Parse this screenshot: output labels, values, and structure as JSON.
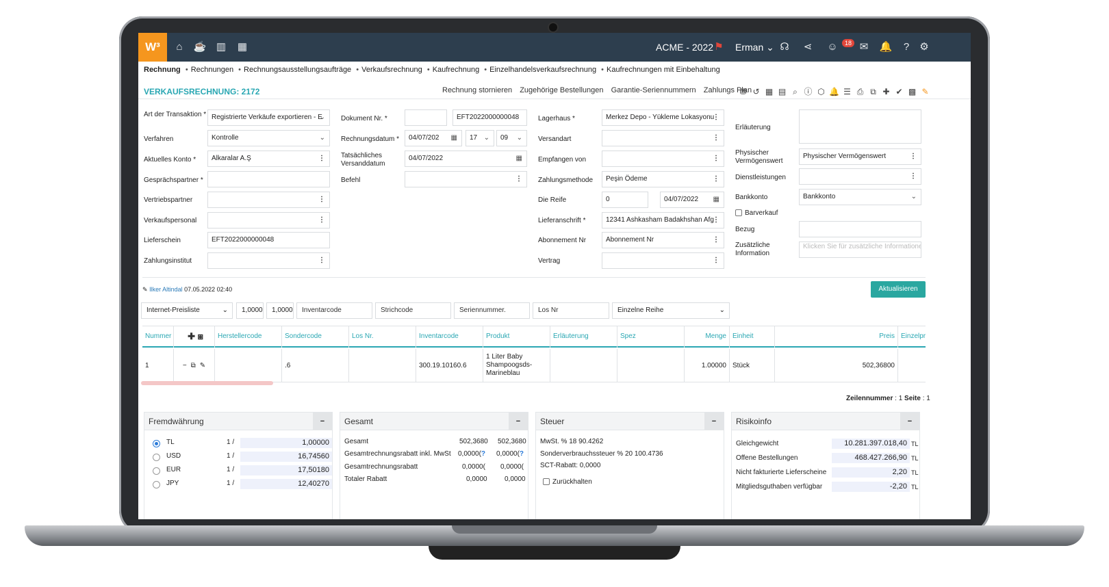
{
  "topbar": {
    "logo": "W³",
    "company": "ACME - 2022",
    "user": "Erman",
    "notifications_count": "18",
    "icons": [
      "home-icon",
      "coffee-icon",
      "chart-icon",
      "calendar-icon",
      "headset-icon",
      "share-icon",
      "smiley-icon",
      "chat-icon",
      "bell-icon",
      "help-icon",
      "gear-icon"
    ]
  },
  "breadcrumb": [
    "Rechnung",
    "Rechnungen",
    "Rechnungsausstellungsaufträge",
    "Verkaufsrechnung",
    "Kaufrechnung",
    "Einzelhandelsverkaufsrechnung",
    "Kaufrechnungen mit Einbehaltung"
  ],
  "title": "VERKAUFSRECHNUNG: 2172",
  "actions": [
    "Rechnung stornieren",
    "Zugehörige Bestellungen",
    "Garantie-Seriennummern",
    "Zahlungs Plan"
  ],
  "toolbar_glyphs": [
    "⛃",
    "↺",
    "▦",
    "▤",
    "⌕",
    "ⓘ",
    "⬡",
    "🔔",
    "☰",
    "⎙",
    "⧉",
    "✚",
    "✔",
    "▩",
    "✎"
  ],
  "form": {
    "col1": {
      "art_label": "Art der Transaktion *",
      "art_value": "Registrierte Verkäufe exportieren - E",
      "verfahren_label": "Verfahren",
      "verfahren_value": "Kontrolle",
      "konto_label": "Aktuelles Konto *",
      "konto_value": "Alkaralar A.Ş",
      "partner_label": "Gesprächspartner *",
      "vertrieb_label": "Vertriebspartner",
      "personal_label": "Verkaufspersonal",
      "lieferschein_label": "Lieferschein",
      "lieferschein_value": "EFT2022000000048",
      "zahlungsinst_label": "Zahlungsinstitut"
    },
    "col2": {
      "dokument_label": "Dokument Nr. *",
      "dokument_value": "EFT2022000000048",
      "rdatum_label": "Rechnungsdatum *",
      "rdatum_value": "04/07/202",
      "hour": "17",
      "minute": "09",
      "tdatum_label": "Tatsächliches Versanddatum",
      "tdatum_value": "04/07/2022",
      "befehl_label": "Befehl"
    },
    "col3": {
      "lagerhaus_label": "Lagerhaus *",
      "lagerhaus_value": "Merkez Depo - Yükleme Lokasyonu",
      "versandart_label": "Versandart",
      "empfangen_label": "Empfangen von",
      "zahlungsmethode_label": "Zahlungsmethode",
      "zahlungsmethode_value": "Peşin Ödeme",
      "reife_label": "Die Reife",
      "reife_value": "0",
      "reife_date": "04/07/2022",
      "lieferanschrift_label": "Lieferanschrift *",
      "lieferanschrift_value": "12341 Ashkasham Badakhshan Afg",
      "abonnement_label": "Abonnement Nr",
      "abonnement_placeholder": "Abonnement Nr",
      "vertrag_label": "Vertrag"
    },
    "col4": {
      "erlaeuterung_label": "Erläuterung",
      "physisch_label": "Physischer Vermögenswert",
      "physisch_placeholder": "Physischer Vermögenswert",
      "dienst_label": "Dienstleistungen",
      "bankkonto_label": "Bankkonto",
      "bankkonto_value": "Bankkonto",
      "barverkauf_label": "Barverkauf",
      "bezug_label": "Bezug",
      "zusatz_label": "Zusätzliche Information",
      "zusatz_button": "Klicken Sie für zusätzliche Informationen"
    }
  },
  "author": {
    "name": "Ilker Altindal",
    "timestamp": "07.05.2022 02:40"
  },
  "update_button": "Aktualisieren",
  "filters": {
    "preisliste": "Internet-Preisliste",
    "qty1": "1,0000",
    "qty2": "1,0000",
    "inventarcode": "Inventarcode",
    "strichcode": "Strichcode",
    "seriennummer": "Seriennummer.",
    "losnr": "Los Nr",
    "reihe": "Einzelne Reihe"
  },
  "table": {
    "headers": [
      "Nummer",
      "Herstellercode",
      "Sondercode",
      "Los Nr.",
      "Inventarcode",
      "Produkt",
      "Erläuterung",
      "Spez",
      "Menge",
      "Einheit",
      "Preis",
      "Einzelpr"
    ],
    "row": {
      "nummer": "1",
      "herstellercode": "",
      "sondercode": ".6",
      "losnr": "",
      "inventarcode": "300.19.10160.6",
      "produkt": "1 Liter Baby Shampoogsds-Marineblau",
      "erlaeuterung": "",
      "spez": "",
      "menge": "1.00000",
      "einheit": "Stück",
      "preis": "502,36800"
    }
  },
  "pageinfo": {
    "label1": "Zeilennummer",
    "val1": "1",
    "label2": "Seite",
    "val2": "1"
  },
  "panels": {
    "fremd": {
      "title": "Fremdwährung",
      "rows": [
        {
          "cur": "TL",
          "ratio": "1 /",
          "value": "1,00000",
          "selected": true
        },
        {
          "cur": "USD",
          "ratio": "1 /",
          "value": "16,74560",
          "selected": false
        },
        {
          "cur": "EUR",
          "ratio": "1 /",
          "value": "17,50180",
          "selected": false
        },
        {
          "cur": "JPY",
          "ratio": "1 /",
          "value": "12,40270",
          "selected": false
        }
      ]
    },
    "gesamt": {
      "title": "Gesamt",
      "rows": [
        {
          "label": "Gesamt",
          "v1": "502,3680",
          "v2": "502,3680"
        },
        {
          "label": "Gesamtrechnungsrabatt inkl. MwSt",
          "v1": "0,0000(",
          "v2": "0,0000("
        },
        {
          "label": "Gesamtrechnungsrabatt",
          "v1": "0,0000(",
          "v2": "0,0000("
        },
        {
          "label": "Totaler Rabatt",
          "v1": "0,0000",
          "v2": "0,0000"
        }
      ]
    },
    "steuer": {
      "title": "Steuer",
      "line1": "MwSt. % 18 90.4262",
      "line2": "Sonderverbrauchssteuer % 20 100.4736",
      "line3": "SCT-Rabatt: 0,0000",
      "zurueck": "Zurückhalten"
    },
    "risiko": {
      "title": "Risikoinfo",
      "rows": [
        {
          "label": "Gleichgewicht",
          "value": "10.281.397.018,40",
          "unit": "TL"
        },
        {
          "label": "Offene Bestellungen",
          "value": "468.427.266,90",
          "unit": "TL"
        },
        {
          "label": "Nicht fakturierte Lieferscheine",
          "value": "2,20",
          "unit": "TL"
        },
        {
          "label": "Mitgliedsguthaben verfügbar",
          "value": "-2,20",
          "unit": "TL"
        }
      ]
    }
  },
  "colors": {
    "topbar": "#2d3e4e",
    "accent": "#2aa7b3",
    "logo": "#f5961e",
    "button": "#2aa7a0"
  }
}
